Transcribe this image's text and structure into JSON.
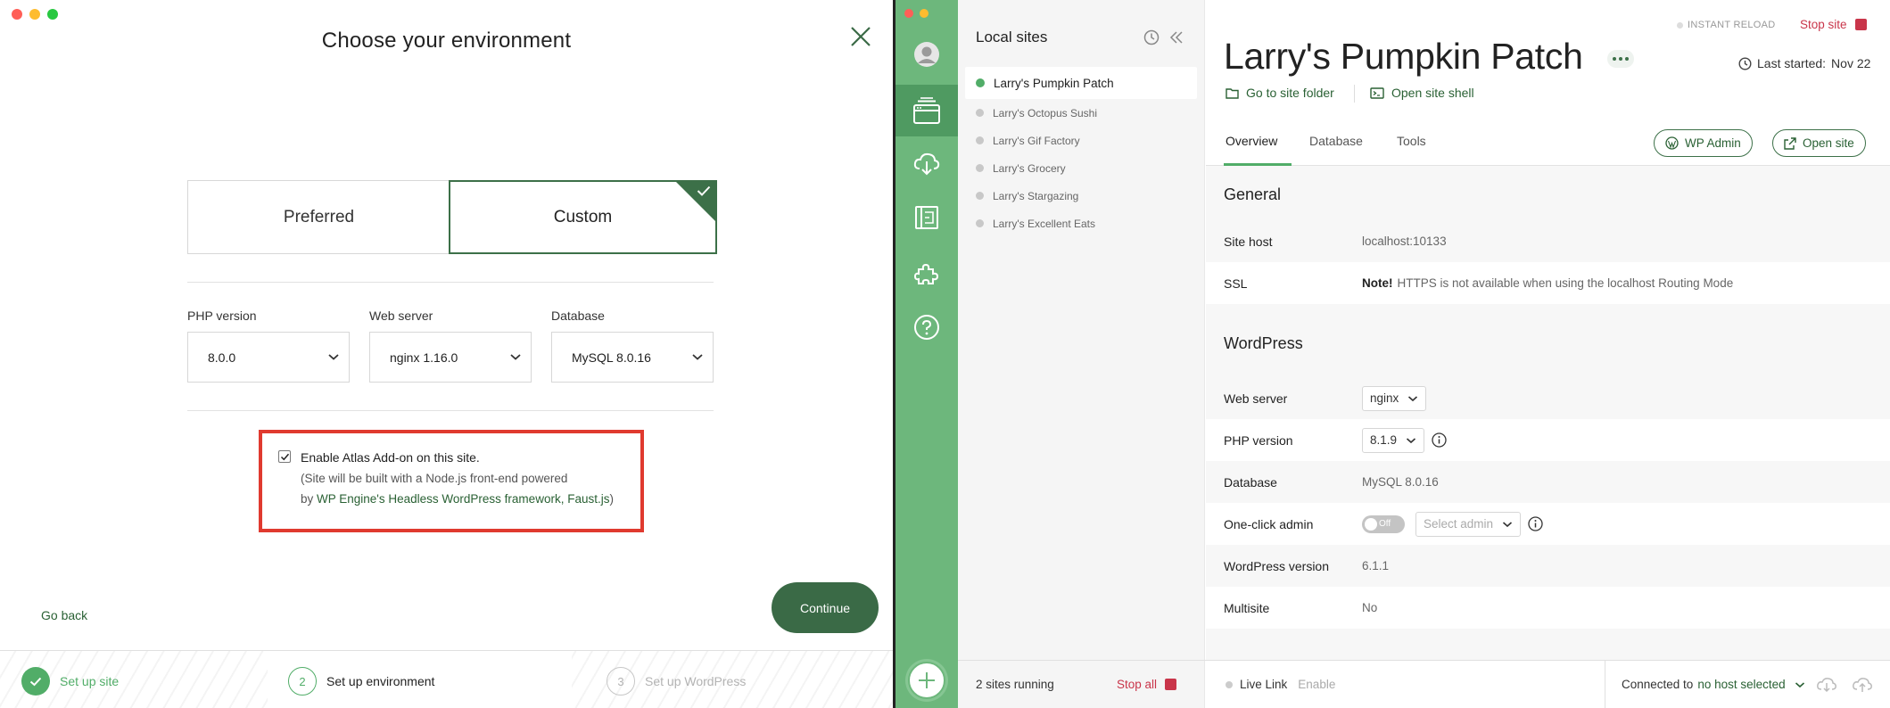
{
  "env_dialog": {
    "title": "Choose your environment",
    "cards": {
      "preferred": "Preferred",
      "custom": "Custom"
    },
    "selects": [
      {
        "label": "PHP version",
        "value": "8.0.0"
      },
      {
        "label": "Web server",
        "value": "nginx 1.16.0"
      },
      {
        "label": "Database",
        "value": "MySQL 8.0.16"
      }
    ],
    "atlas": {
      "checked": true,
      "label": "Enable Atlas Add-on on this site.",
      "desc_line1": "(Site will be built with a Node.js front-end powered",
      "desc_prefix": "by ",
      "desc_link": "WP Engine's Headless WordPress framework, Faust.js",
      "desc_suffix": ")"
    },
    "go_back": "Go back",
    "continue": "Continue",
    "steps": [
      {
        "number": "",
        "label": "Set up site",
        "state": "done"
      },
      {
        "number": "2",
        "label": "Set up environment",
        "state": "active"
      },
      {
        "number": "3",
        "label": "Set up WordPress",
        "state": "todo"
      }
    ]
  },
  "local_app": {
    "sidebar_title": "Local sites",
    "sites": [
      {
        "name": "Larry's Pumpkin Patch",
        "active": true
      },
      {
        "name": "Larry's Octopus Sushi",
        "active": false
      },
      {
        "name": "Larry's Gif Factory",
        "active": false
      },
      {
        "name": "Larry's Grocery",
        "active": false
      },
      {
        "name": "Larry's Stargazing",
        "active": false
      },
      {
        "name": "Larry's Excellent Eats",
        "active": false
      }
    ],
    "header": {
      "instant_reload": "INSTANT RELOAD",
      "stop_site": "Stop site",
      "site_title": "Larry's Pumpkin Patch",
      "last_started_label": "Last started:",
      "last_started_value": "Nov 22",
      "go_to_folder": "Go to site folder",
      "open_shell": "Open site shell"
    },
    "tabs": [
      "Overview",
      "Database",
      "Tools"
    ],
    "buttons": {
      "wp_admin": "WP Admin",
      "open_site": "Open site"
    },
    "general": {
      "heading": "General",
      "site_host_label": "Site host",
      "site_host_value": "localhost:10133",
      "ssl_label": "SSL",
      "ssl_note": "Note!",
      "ssl_value": "HTTPS is not available when using the localhost Routing Mode"
    },
    "wordpress": {
      "heading": "WordPress",
      "web_server_label": "Web server",
      "web_server_value": "nginx",
      "php_label": "PHP version",
      "php_value": "8.1.9",
      "database_label": "Database",
      "database_value": "MySQL 8.0.16",
      "one_click_label": "One-click admin",
      "toggle_state": "Off",
      "select_admin_placeholder": "Select admin",
      "wp_version_label": "WordPress version",
      "wp_version_value": "6.1.1",
      "multisite_label": "Multisite",
      "multisite_value": "No"
    },
    "bottom": {
      "sites_running": "2 sites running",
      "stop_all": "Stop all",
      "live_link": "Live Link",
      "enable": "Enable",
      "connected_to": "Connected to",
      "host": "no host selected"
    },
    "colors": {
      "brand_green": "#51ad68",
      "rail_green": "#6db77c",
      "stop_red": "#c9354a",
      "highlight_red": "#e03a2f"
    }
  }
}
